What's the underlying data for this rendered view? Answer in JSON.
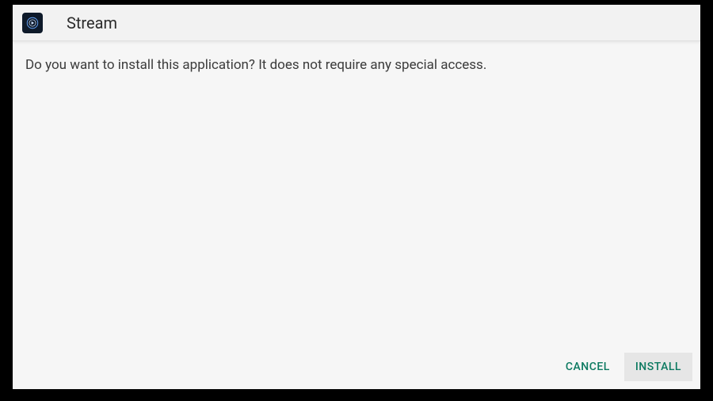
{
  "header": {
    "app_title": "Stream",
    "icon_name": "stream-app-icon"
  },
  "content": {
    "message": "Do you want to install this application? It does not require any special access."
  },
  "footer": {
    "cancel_label": "CANCEL",
    "install_label": "INSTALL"
  }
}
